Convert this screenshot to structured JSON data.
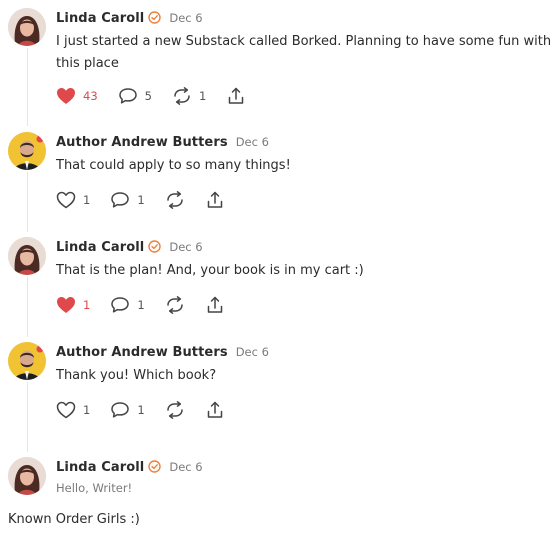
{
  "thread": [
    {
      "author": "Linda Caroll",
      "date": "Dec 6",
      "text": "I just started a new Substack called Borked. Planning to have some fun with this place",
      "likes": "43",
      "liked": true,
      "comments": "5",
      "restacks": "1"
    },
    {
      "author": "Author Andrew Butters",
      "date": "Dec 6",
      "text": "That could apply to so many things!",
      "likes": "1",
      "liked": false,
      "comments": "1"
    },
    {
      "author": "Linda Caroll",
      "date": "Dec 6",
      "text": "That is the plan! And, your book is in my cart :)",
      "likes": "1",
      "liked": true,
      "comments": "1"
    },
    {
      "author": "Author Andrew Butters",
      "date": "Dec 6",
      "text": "Thank you! Which book?",
      "likes": "1",
      "liked": false,
      "comments": "1"
    },
    {
      "author": "Linda Caroll",
      "date": "Dec 6",
      "subtitle": "Hello, Writer!"
    }
  ],
  "footer_text": "Known Order Girls :)",
  "colors": {
    "like_active": "#e0494b",
    "verified": "#f0803c",
    "text": "#2b2b2b",
    "muted": "#7a7a7a"
  },
  "icons": [
    "heart-icon",
    "comment-icon",
    "restack-icon",
    "share-icon",
    "verified-badge-icon"
  ]
}
